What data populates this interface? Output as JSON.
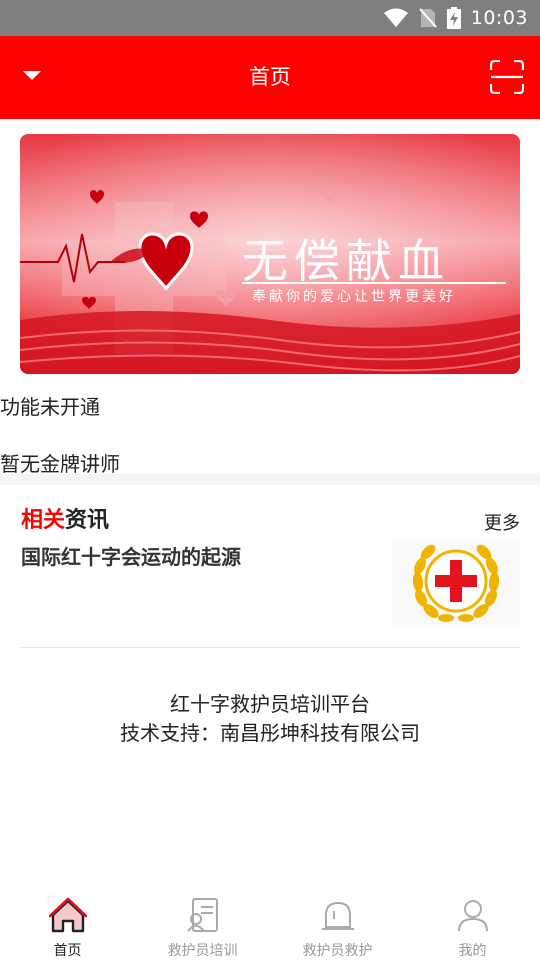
{
  "status_bar": {
    "time": "10:03"
  },
  "header": {
    "title": "首页"
  },
  "banner": {
    "heading": "无偿献血",
    "slogan": "奉献你的爱心让世界更美好"
  },
  "notices": {
    "feature_status": "功能未开通",
    "instructor_status": "暂无金牌讲师"
  },
  "news": {
    "title_highlight": "相关",
    "title_rest": "资讯",
    "more_label": "更多",
    "items": [
      {
        "title": "国际红十字会运动的起源"
      }
    ]
  },
  "footer": {
    "platform": "红十字救护员培训平台",
    "support": "技术支持：南昌彤坤科技有限公司"
  },
  "bottom_nav": {
    "items": [
      {
        "label": "首页",
        "icon": "home-icon",
        "active": true
      },
      {
        "label": "救护员培训",
        "icon": "training-doc-icon",
        "active": false
      },
      {
        "label": "救护员救护",
        "icon": "rescue-alarm-icon",
        "active": false
      },
      {
        "label": "我的",
        "icon": "user-icon",
        "active": false
      }
    ]
  },
  "colors": {
    "primary": "#ff0000",
    "status_bar": "#7f7f7f",
    "inactive": "#999999"
  }
}
